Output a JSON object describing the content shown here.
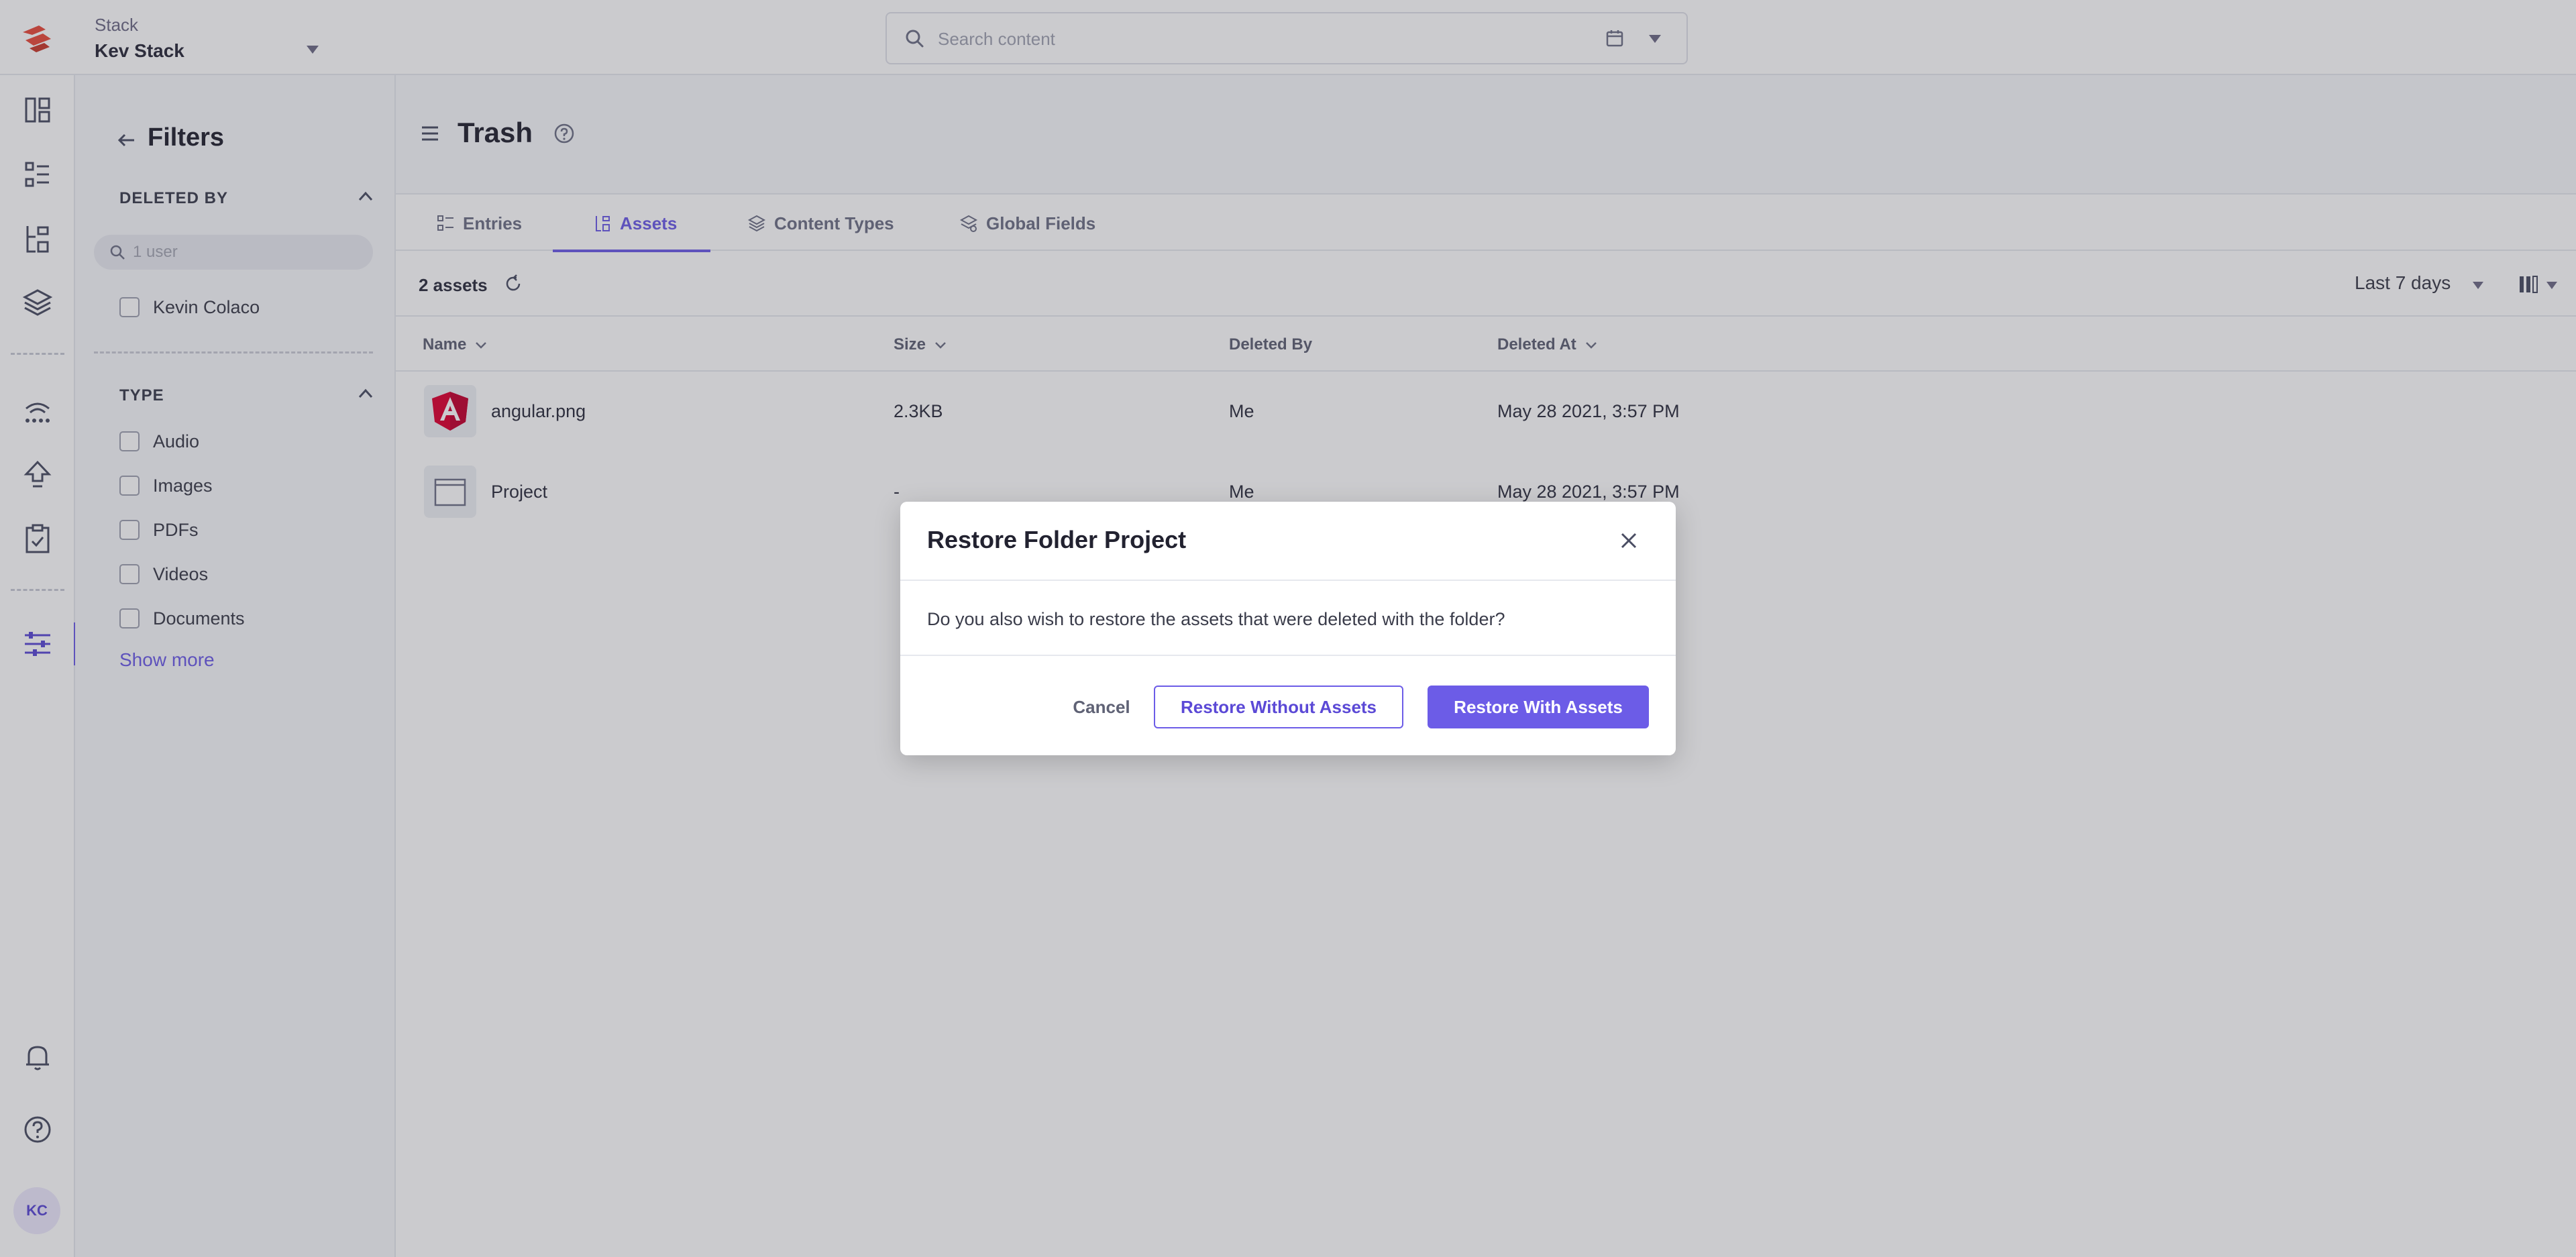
{
  "topbar": {
    "stack_label": "Stack",
    "stack_name": "Kev Stack",
    "search_placeholder": "Search content"
  },
  "rail": {
    "icons": [
      "dashboard-icon",
      "entries-icon",
      "assets-icon",
      "content-types-icon",
      "extensions-icon",
      "publish-queue-icon",
      "tasks-icon",
      "settings-icon",
      "notifications-icon",
      "help-icon"
    ],
    "avatar_initials": "KC"
  },
  "filters": {
    "title": "Filters",
    "deleted_by": {
      "title": "DELETED BY",
      "search_placeholder": "1 user",
      "options": [
        "Kevin Colaco"
      ]
    },
    "type": {
      "title": "TYPE",
      "options": [
        "Audio",
        "Images",
        "PDFs",
        "Videos",
        "Documents"
      ]
    },
    "show_more": "Show more"
  },
  "page": {
    "title": "Trash",
    "tabs": [
      {
        "label": "Entries",
        "active": false
      },
      {
        "label": "Assets",
        "active": true
      },
      {
        "label": "Content Types",
        "active": false
      },
      {
        "label": "Global Fields",
        "active": false
      }
    ],
    "asset_count": "2 assets",
    "date_range": "Last 7 days"
  },
  "table": {
    "columns": [
      "Name",
      "Size",
      "Deleted By",
      "Deleted At"
    ],
    "rows": [
      {
        "name": "angular.png",
        "size": "2.3KB",
        "deleted_by": "Me",
        "deleted_at": "May 28 2021, 3:57 PM",
        "kind": "image"
      },
      {
        "name": "Project",
        "size": "-",
        "deleted_by": "Me",
        "deleted_at": "May 28 2021, 3:57 PM",
        "kind": "folder"
      }
    ]
  },
  "modal": {
    "title": "Restore Folder Project",
    "message": "Do you also wish to restore the assets that were deleted with the folder?",
    "cancel_label": "Cancel",
    "restore_without_label": "Restore Without Assets",
    "restore_with_label": "Restore With Assets"
  },
  "colors": {
    "accent": "#6c5ce7",
    "brand_logo": "#e94b3c",
    "overlay": "#373842"
  }
}
